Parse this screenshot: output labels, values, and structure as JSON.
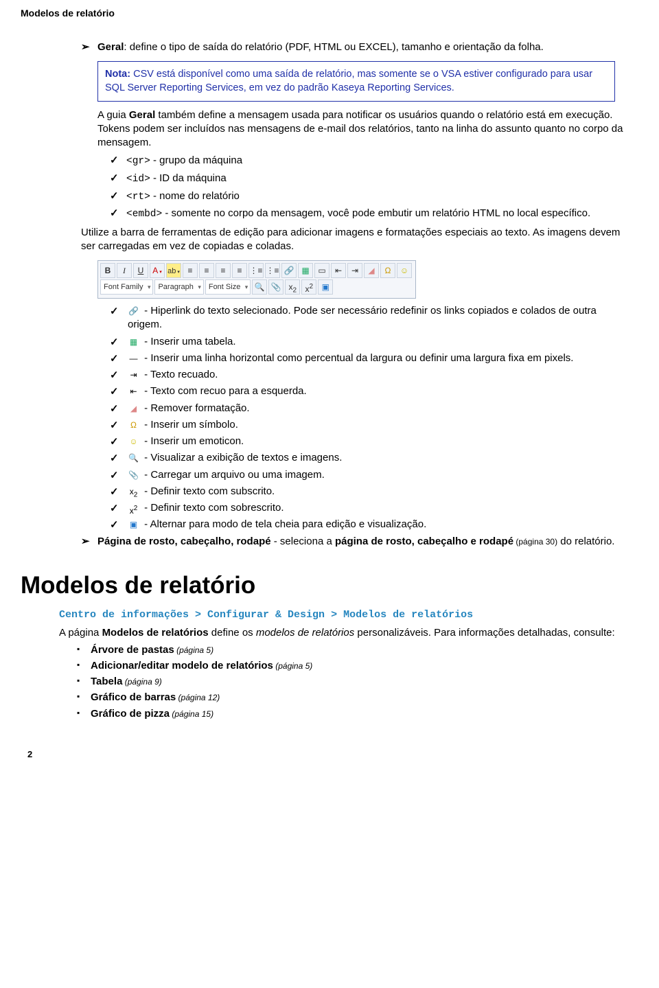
{
  "header": "Modelos de relatório",
  "geral_label": "Geral",
  "geral_text": ": define o tipo de saída do relatório (PDF, HTML ou EXCEL), tamanho e orientação da folha.",
  "nota_label": "Nota:",
  "nota_text": " CSV está disponível como uma saída de relatório, mas somente se o VSA estiver configurado para usar SQL Server Reporting Services, em vez do padrão Kaseya Reporting Services.",
  "para1_a": "A guia ",
  "para1_b": "Geral",
  "para1_c": " também define a mensagem usada para notificar os usuários quando o relatório está em execução. Tokens podem ser incluídos nas mensagens de e-mail dos relatórios, tanto na linha do assunto quanto no corpo da mensagem.",
  "tokens": {
    "gr_code": "<gr>",
    "gr_text": " - grupo da máquina",
    "id_code": "<id>",
    "id_text": " - ID da máquina",
    "rt_code": "<rt>",
    "rt_text": " - nome do relatório",
    "embd_code": "<embd>",
    "embd_text": " - somente no corpo da mensagem, você pode embutir um relatório HTML no local específico."
  },
  "para2": "Utilize a barra de ferramentas de edição para adicionar imagens e formatações especiais ao texto. As imagens devem ser carregadas em vez de copiadas e coladas.",
  "toolbar": {
    "bold": "B",
    "italic": "I",
    "underline": "U",
    "font_family": "Font Family",
    "paragraph": "Paragraph",
    "font_size": "Font Size",
    "omega": "Ω",
    "smile": "☺"
  },
  "tools": {
    "hyperlink": " - Hiperlink do texto selecionado. Pode ser necessário redefinir os links copiados e colados de outra origem.",
    "table": " - Inserir uma tabela.",
    "hr": " - Inserir uma linha horizontal como percentual da largura ou definir uma largura fixa em pixels.",
    "indent": " - Texto recuado.",
    "outdent": " - Texto com recuo para a esquerda.",
    "removefmt": " - Remover formatação.",
    "symbol": " - Inserir um símbolo.",
    "emoticon": " - Inserir um emoticon.",
    "preview": " - Visualizar a exibição de textos e imagens.",
    "upload": " - Carregar um arquivo ou uma imagem.",
    "subscript": " - Definir texto com subscrito.",
    "superscript": " - Definir texto com sobrescrito.",
    "fullscreen": " - Alternar para modo de tela cheia para edição e visualização."
  },
  "prc_label": "Página de rosto, cabeçalho, rodapé",
  "prc_text_a": " - seleciona a ",
  "prc_text_b": "página de rosto, cabeçalho e rodapé",
  "prc_pref": " (página 30)",
  "prc_text_c": " do relatório.",
  "big_title": "Modelos de relatório",
  "breadcrumb": "Centro de informações > Configurar & Design > Modelos de relatórios",
  "sec_p_a": "A página ",
  "sec_p_b": "Modelos de relatórios",
  "sec_p_c": " define os ",
  "sec_p_d": "modelos de relatórios",
  "sec_p_e": " personalizáveis. Para informações detalhadas, consulte:",
  "links": {
    "l1": "Árvore de pastas",
    "l1p": " (página 5)",
    "l2": "Adicionar/editar modelo de relatórios",
    "l2p": " (página 5)",
    "l3": "Tabela",
    "l3p": " (página 9)",
    "l4": "Gráfico de barras",
    "l4p": " (página 12)",
    "l5": "Gráfico de pizza",
    "l5p": " (página 15)"
  },
  "page_number": "2"
}
